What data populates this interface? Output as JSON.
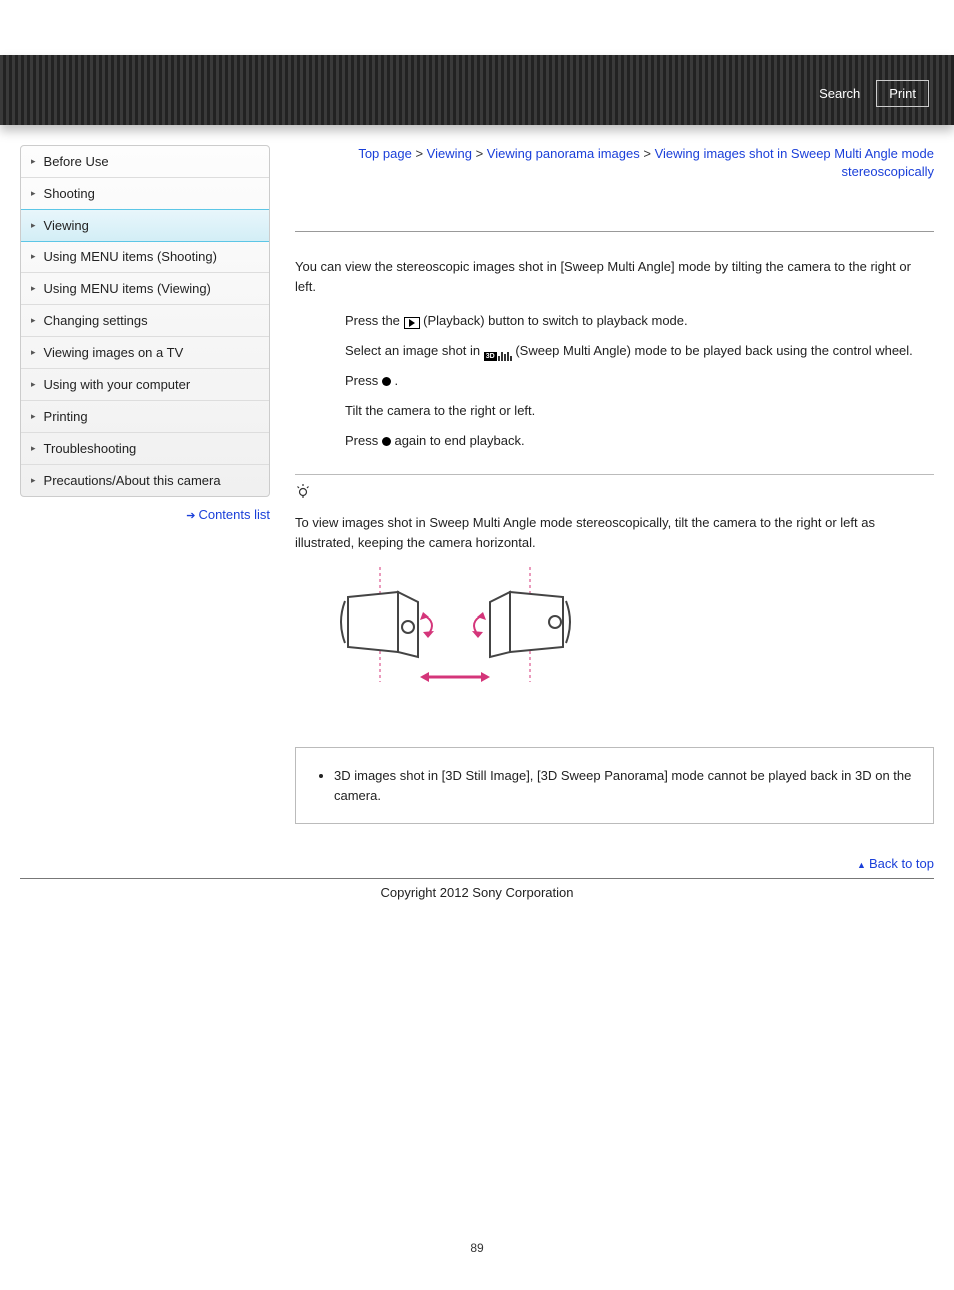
{
  "header": {
    "search_label": "Search",
    "print_label": "Print"
  },
  "sidebar": {
    "items": [
      {
        "label": "Before Use",
        "active": false
      },
      {
        "label": "Shooting",
        "active": false
      },
      {
        "label": "Viewing",
        "active": true
      },
      {
        "label": "Using MENU items (Shooting)",
        "active": false
      },
      {
        "label": "Using MENU items (Viewing)",
        "active": false
      },
      {
        "label": "Changing settings",
        "active": false
      },
      {
        "label": "Viewing images on a TV",
        "active": false
      },
      {
        "label": "Using with your computer",
        "active": false
      },
      {
        "label": "Printing",
        "active": false
      },
      {
        "label": "Troubleshooting",
        "active": false
      },
      {
        "label": "Precautions/About this camera",
        "active": false
      }
    ],
    "contents_list_label": "Contents list"
  },
  "breadcrumb": {
    "parts": [
      "Top page",
      "Viewing",
      "Viewing panorama images",
      "Viewing images shot in Sweep Multi Angle mode stereoscopically"
    ],
    "sep": " > "
  },
  "content": {
    "intro": "You can view the stereoscopic images shot in [Sweep Multi Angle] mode by tilting the camera to the right or left.",
    "step1_a": "Press the ",
    "step1_b": " (Playback) button to switch to playback mode.",
    "step2_a": "Select an image shot in ",
    "step2_b": " (Sweep Multi Angle) mode to be played back using the control wheel.",
    "step3_a": "Press ",
    "step3_b": " .",
    "step4": "Tilt the camera to the right or left.",
    "step5_a": "Press ",
    "step5_b": "  again to end playback.",
    "tip_text": "To view images shot in Sweep Multi Angle mode stereoscopically, tilt the camera to the right or left as illustrated, keeping the camera horizontal.",
    "note": "3D images shot in [3D Still Image], [3D Sweep Panorama] mode cannot be played back in 3D on the camera."
  },
  "footer": {
    "back_to_top": "Back to top",
    "copyright": "Copyright 2012 Sony Corporation",
    "page_number": "89"
  }
}
